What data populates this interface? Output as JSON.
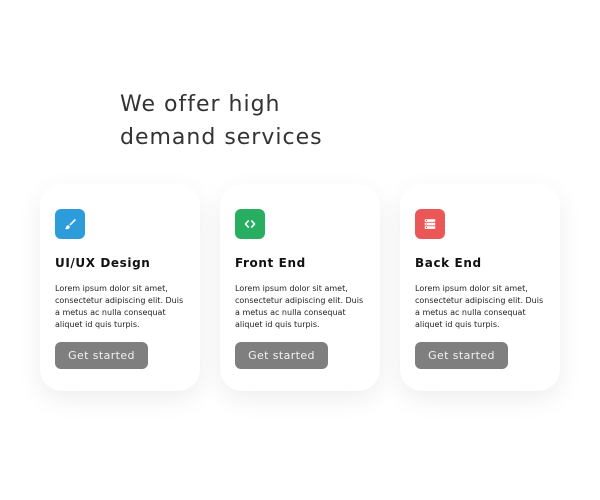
{
  "hero": {
    "line1": "We offer high",
    "line2": "demand services"
  },
  "services": [
    {
      "title": "UI/UX Design",
      "icon": "brush-icon",
      "color": "#2d9cdb",
      "description": "Lorem ipsum dolor sit amet, consectetur adipiscing elit. Duis a metus ac nulla consequat aliquet id quis turpis.",
      "cta": "Get started"
    },
    {
      "title": "Front End",
      "icon": "code-icon",
      "color": "#27ae60",
      "description": "Lorem ipsum dolor sit amet, consectetur adipiscing elit. Duis a metus ac nulla consequat aliquet id quis turpis.",
      "cta": "Get started"
    },
    {
      "title": "Back End",
      "icon": "server-icon",
      "color": "#eb5757",
      "description": "Lorem ipsum dolor sit amet, consectetur adipiscing elit. Duis a metus ac nulla consequat aliquet id quis turpis.",
      "cta": "Get started"
    }
  ]
}
